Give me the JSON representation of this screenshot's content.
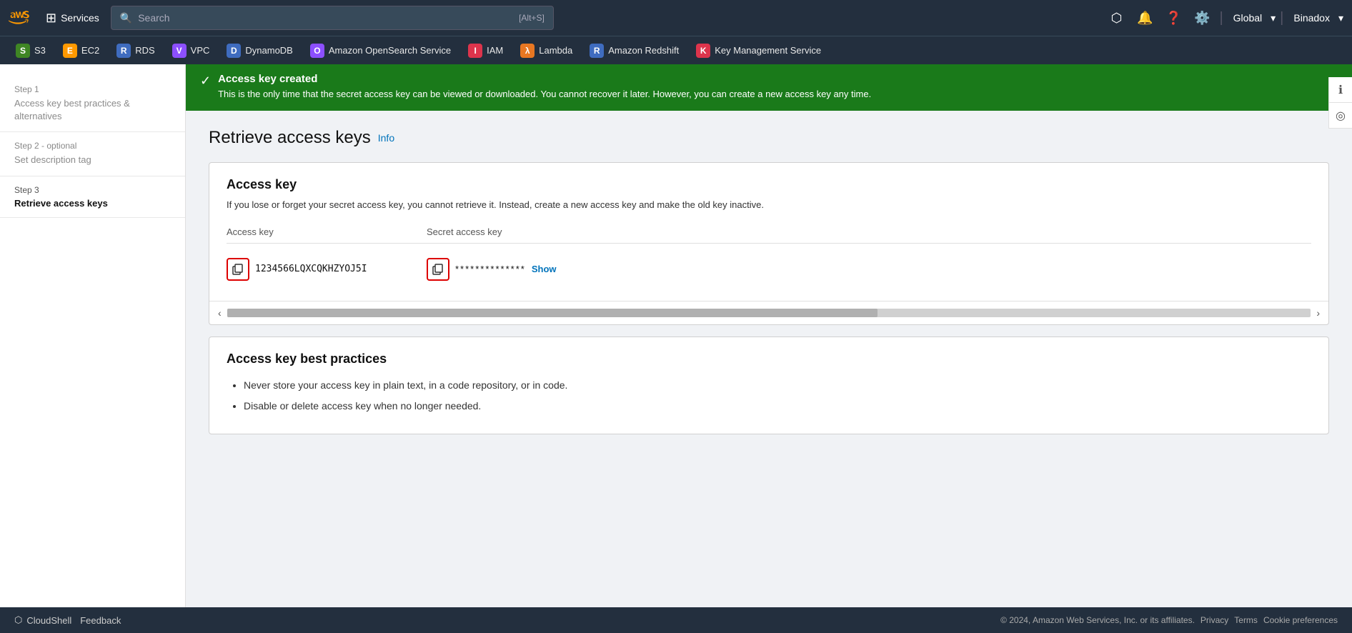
{
  "nav": {
    "search_placeholder": "Search",
    "search_shortcut": "[Alt+S]",
    "services_label": "Services",
    "region": "Global",
    "account": "Binadox",
    "cloudshell_label": "CloudShell",
    "feedback_label": "Feedback"
  },
  "service_tabs": [
    {
      "id": "s3",
      "label": "S3",
      "color": "#3f8624",
      "icon": "S"
    },
    {
      "id": "ec2",
      "label": "EC2",
      "color": "#ff9900",
      "icon": "E"
    },
    {
      "id": "rds",
      "label": "RDS",
      "color": "#3f6cbf",
      "icon": "R"
    },
    {
      "id": "vpc",
      "label": "VPC",
      "color": "#8c4fff",
      "icon": "V"
    },
    {
      "id": "dynamodb",
      "label": "DynamoDB",
      "color": "#3f6cbf",
      "icon": "D"
    },
    {
      "id": "opensearch",
      "label": "Amazon OpenSearch Service",
      "color": "#8c4fff",
      "icon": "O"
    },
    {
      "id": "iam",
      "label": "IAM",
      "color": "#dd344c",
      "icon": "I"
    },
    {
      "id": "lambda",
      "label": "Lambda",
      "color": "#e87722",
      "icon": "λ"
    },
    {
      "id": "redshift",
      "label": "Amazon Redshift",
      "color": "#3f6cbf",
      "icon": "R"
    },
    {
      "id": "kms",
      "label": "Key Management Service",
      "color": "#dd344c",
      "icon": "K"
    }
  ],
  "banner": {
    "title": "Access key created",
    "description": "This is the only time that the secret access key can be viewed or downloaded. You cannot recover it later. However, you can create a new access key any time."
  },
  "sidebar": {
    "step1_label": "Step 1",
    "step1_link": "Access key best practices & alternatives",
    "step2_label": "Step 2 - optional",
    "step2_link": "Set description tag",
    "step3_label": "Step 3",
    "step3_title": "Retrieve access keys"
  },
  "main": {
    "page_title": "Retrieve access keys",
    "info_link": "Info",
    "access_key_section": {
      "title": "Access key",
      "description": "If you lose or forget your secret access key, you cannot retrieve it. Instead, create a new access key and make the old key inactive.",
      "access_key_col": "Access key",
      "secret_key_col": "Secret access key",
      "access_key_value": "1234566LQXCQKHZYOJ5I",
      "secret_key_masked": "**************",
      "show_label": "Show"
    },
    "best_practices_section": {
      "title": "Access key best practices",
      "practices": [
        "Never store your access key in plain text, in a code repository, or in code.",
        "Disable or delete access key when no longer needed."
      ]
    }
  },
  "footer": {
    "copyright": "© 2024, Amazon Web Services, Inc. or its affiliates.",
    "privacy_label": "Privacy",
    "terms_label": "Terms",
    "cookie_label": "Cookie preferences"
  }
}
